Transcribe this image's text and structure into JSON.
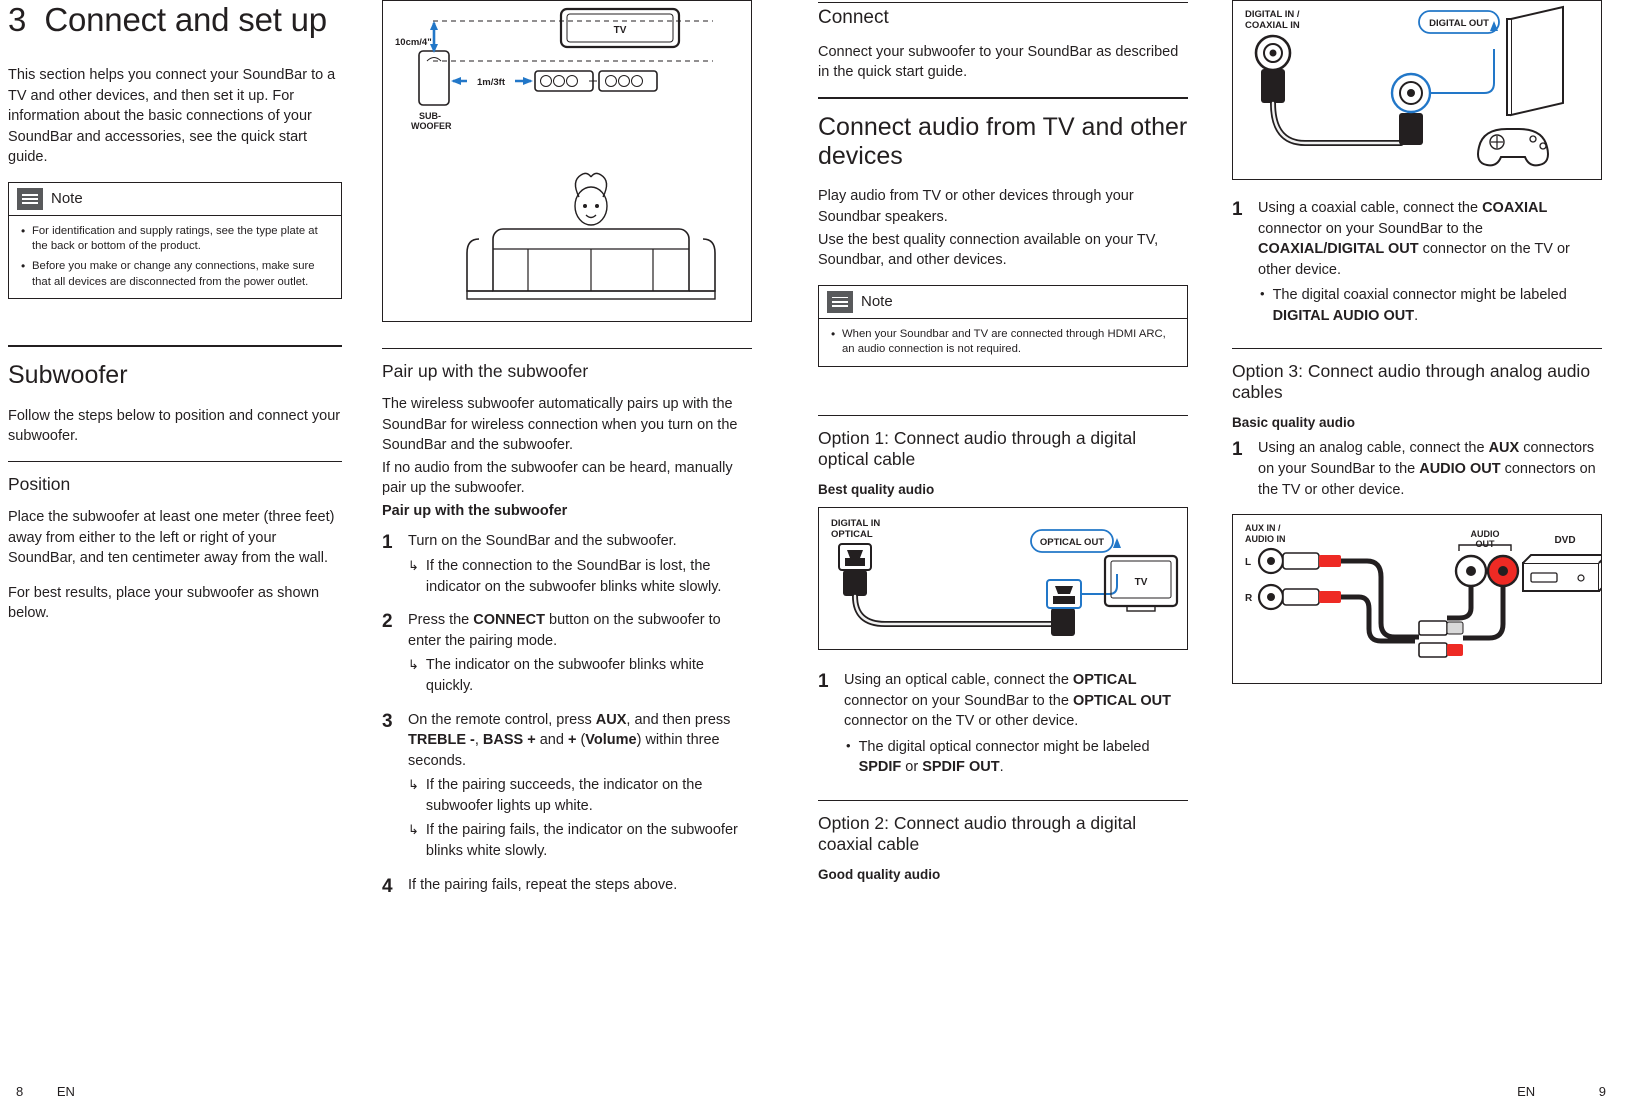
{
  "left_page": {
    "chapter": {
      "number": "3",
      "title": "Connect and set up"
    },
    "intro": "This section helps you connect your SoundBar to a TV and other devices, and then set it up. For information about the basic connections of your SoundBar and accessories, see the quick start guide.",
    "note": {
      "title": "Note",
      "items": [
        "For identification and supply ratings, see the type plate at the back or bottom of the product.",
        "Before you make or change any connections, make sure that all devices are disconnected from the power outlet."
      ]
    },
    "subwoofer": {
      "heading": "Subwoofer",
      "intro": "Follow the steps below to position and connect your subwoofer.",
      "position_heading": "Position",
      "position_text_1": "Place the subwoofer at least one meter (three feet) away from either to the left or right of your SoundBar, and ten centimeter away from the wall.",
      "position_text_2": "For best results, place your subwoofer as shown below."
    },
    "fig_placement": {
      "label_distance_top": "10cm/4\"",
      "label_distance_side": "1m/3ft",
      "label_tv": "TV",
      "label_sub_line1": "SUB-",
      "label_sub_line2": "WOOFER"
    },
    "pair": {
      "heading": "Pair up with the subwoofer",
      "para": "The wireless subwoofer automatically pairs up with the SoundBar for wireless connection when you turn on the SoundBar and the subwoofer.",
      "para2": "If no audio from the subwoofer can be heard, manually pair up the subwoofer.",
      "bold_heading": "Pair up with the subwoofer",
      "steps": [
        {
          "num": "1",
          "text": "Turn on the SoundBar and the subwoofer.",
          "arrows": [
            "If the connection to the SoundBar is lost, the indicator on the subwoofer blinks white slowly."
          ]
        },
        {
          "num": "2",
          "text_html": "Press the <b>CONNECT</b> button on the subwoofer to enter the pairing mode.",
          "arrows": [
            "The indicator on the subwoofer blinks white quickly."
          ]
        },
        {
          "num": "3",
          "text_html": "On the remote control, press <b>AUX</b>, and then press <b>TREBLE -</b>, <b>BASS +</b> and <b>+</b> (<b>Volume</b>) within three seconds.",
          "arrows": [
            "If the pairing succeeds, the indicator on the subwoofer lights up white.",
            "If the pairing fails, the indicator on the subwoofer blinks white slowly."
          ]
        },
        {
          "num": "4",
          "text": "If the pairing fails, repeat the steps above.",
          "arrows": []
        }
      ]
    },
    "footer": {
      "page": "8",
      "lang": "EN"
    }
  },
  "right_page": {
    "connect": {
      "heading": "Connect",
      "text": "Connect your subwoofer to your SoundBar as described in the quick start guide."
    },
    "connect_audio": {
      "heading": "Connect audio from TV and other devices",
      "para1": "Play audio from TV or other devices through your Soundbar speakers.",
      "para2": "Use the best quality connection available on your TV, Soundbar, and other devices.",
      "note": {
        "title": "Note",
        "items": [
          "When your Soundbar and TV are connected through HDMI ARC, an audio connection is not required."
        ]
      }
    },
    "option1": {
      "heading": "Option 1: Connect audio through a digital optical cable",
      "quality": "Best quality audio",
      "fig": {
        "label_in_line1": "DIGITAL IN",
        "label_in_line2": "OPTICAL",
        "label_out": "OPTICAL OUT",
        "label_tv": "TV"
      },
      "step": {
        "num": "1",
        "text_html": "Using an optical cable, connect the <b>OPTICAL</b> connector on your SoundBar to the <b>OPTICAL OUT</b> connector on the TV or other device.",
        "bullets_html": [
          "The digital optical connector might be labeled <b>SPDIF</b> or <b>SPDIF OUT</b>."
        ]
      }
    },
    "option2": {
      "heading": "Option 2: Connect audio through a digital coaxial cable",
      "quality": "Good quality audio",
      "fig": {
        "label_in_line1": "DIGITAL IN /",
        "label_in_line2": "COAXIAL IN",
        "label_out": "DIGITAL OUT"
      },
      "step": {
        "num": "1",
        "text_html": "Using a coaxial cable, connect the <b>COAXIAL</b> connector on your SoundBar to the <b>COAXIAL/DIGITAL OUT</b> connector on the TV or other device.",
        "bullets_html": [
          "The digital coaxial connector might be labeled <b>DIGITAL AUDIO OUT</b>."
        ]
      }
    },
    "option3": {
      "heading": "Option 3: Connect audio through analog audio cables",
      "quality": "Basic quality audio",
      "step": {
        "num": "1",
        "text_html": "Using an analog cable, connect the <b>AUX</b> connectors on your SoundBar to the <b>AUDIO OUT</b> connectors on the TV or other device."
      },
      "fig": {
        "label_in_line1": "AUX IN /",
        "label_in_line2": "AUDIO IN",
        "label_l": "L",
        "label_r": "R",
        "label_out_line1": "AUDIO",
        "label_out_line2": "OUT",
        "label_dvd": "DVD"
      }
    },
    "footer": {
      "lang": "EN",
      "page": "9"
    }
  }
}
